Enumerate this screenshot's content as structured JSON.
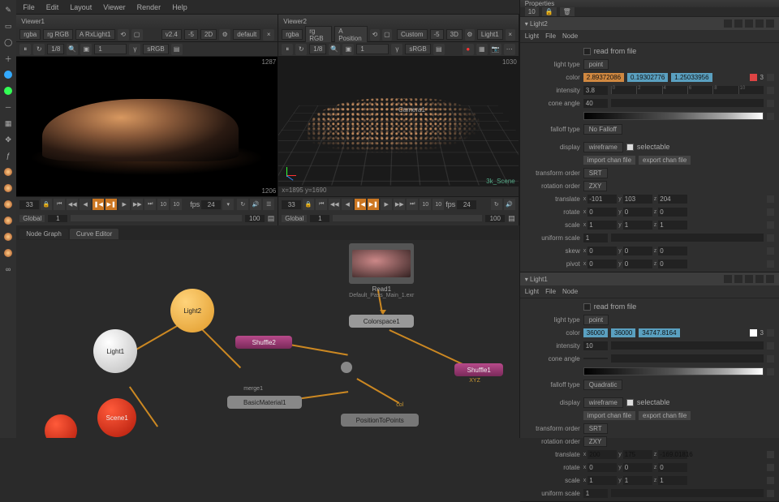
{
  "menu": {
    "file": "File",
    "edit": "Edit",
    "layout": "Layout",
    "viewer": "Viewer",
    "render": "Render",
    "help": "Help"
  },
  "viewer1": {
    "title": "Viewer1",
    "channel": "rgba",
    "cs": "rg RGB",
    "input": "A RxLight1",
    "disp": "2D",
    "zoom": "1/8",
    "gamma": "1",
    "srgb": "sRGB",
    "default": "default",
    "vplus": "v2.4",
    "vminus": "-5",
    "dim1": "1287",
    "dim2": "1206",
    "coords": ""
  },
  "viewer2": {
    "title": "Viewer2",
    "channel": "rgba",
    "cs": "rg RGB",
    "input": "A Position",
    "disp": "3D",
    "zoom": "1/8",
    "gamma": "1",
    "srgb": "sRGB",
    "custom": "Custom",
    "vminus": "-5",
    "light": "Light1",
    "dim1": "1030",
    "coords": "x=1895 y=1690",
    "label3d": "Camera1",
    "corner": "3k_Scene"
  },
  "timeline": {
    "frame": "33",
    "start": "1",
    "end": "100",
    "fps": "24",
    "fpslabel": "fps",
    "scope": "Global",
    "step10": "10"
  },
  "nodegraph": {
    "tab1": "Node Graph",
    "tab2": "Curve Editor",
    "read1": "Read1",
    "read1_sub": "Default_Pass_Main_1.exr",
    "light1": "Light1",
    "light2": "Light2",
    "scene1": "Scene1",
    "shuffle2": "Shuffle2",
    "shuffle1": "Shuffle1",
    "colorspace1": "Colorspace1",
    "basicmat": "BasicMaterial1",
    "merge": "merge1",
    "p2p": "PositionToPoints",
    "xyz": "XYZ",
    "col": "col"
  },
  "props": {
    "title": "Properties",
    "num": "10",
    "panel1": {
      "name": "Light2",
      "tab_light": "Light",
      "tab_file": "File",
      "tab_node": "Node",
      "readfile": "read from file",
      "lighttype_l": "light type",
      "lighttype": "point",
      "color_l": "color",
      "c_r": "2.89372086",
      "c_g": "0.19302776",
      "c_b": "1.25033956",
      "intensity_l": "intensity",
      "intensity": "3.8",
      "cone_l": "cone angle",
      "cone": "40",
      "falloff_l": "falloff type",
      "falloff": "No Falloff",
      "display_l": "display",
      "display": "wireframe",
      "selectable": "selectable",
      "import": "import chan file",
      "export": "export chan file",
      "torder_l": "transform order",
      "torder": "SRT",
      "rorder_l": "rotation order",
      "rorder": "ZXY",
      "translate_l": "translate",
      "tx": "-101",
      "ty": "103",
      "tz": "204",
      "rotate_l": "rotate",
      "rx": "0",
      "ry": "0",
      "rz": "0",
      "scale_l": "scale",
      "sx": "1",
      "sy": "1",
      "sz": "1",
      "uscale_l": "uniform scale",
      "uscale": "1",
      "skew_l": "skew",
      "skx": "0",
      "sky": "0",
      "skz": "0",
      "pivot_l": "pivot",
      "px": "0",
      "py": "0",
      "pz": "0"
    },
    "panel2": {
      "name": "Light1",
      "tab_light": "Light",
      "tab_file": "File",
      "tab_node": "Node",
      "readfile": "read from file",
      "lighttype_l": "light type",
      "lighttype": "point",
      "color_l": "color",
      "c_r": "36000",
      "c_g": "36000",
      "c_b": "34747.8164",
      "intensity_l": "intensity",
      "intensity": "10",
      "cone_l": "cone angle",
      "falloff_l": "falloff type",
      "falloff": "Quadratic",
      "display_l": "display",
      "display": "wireframe",
      "selectable": "selectable",
      "torder_l": "transform order",
      "torder": "SRT",
      "rorder_l": "rotation order",
      "rorder": "ZXY",
      "translate_l": "translate",
      "tx": "200",
      "ty": "175",
      "tz": "-169.01816",
      "rotate_l": "rotate",
      "rx": "0",
      "ry": "0",
      "rz": "0",
      "scale_l": "scale",
      "sx": "1",
      "sy": "1",
      "sz": "1",
      "uscale_l": "uniform scale",
      "uscale": "1",
      "import": "import chan file",
      "export": "export chan file"
    }
  }
}
